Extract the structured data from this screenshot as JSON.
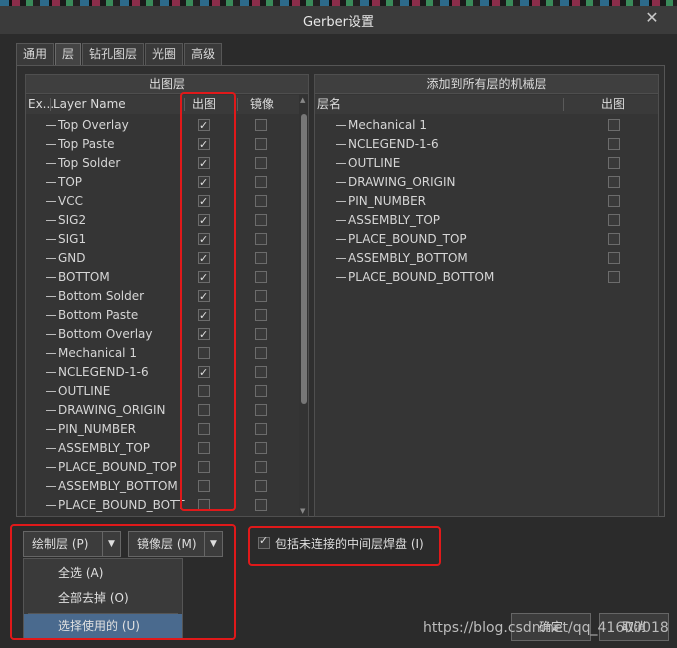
{
  "window": {
    "title": "Gerber设置",
    "close_label": "✕"
  },
  "tabs": [
    {
      "label": "通用"
    },
    {
      "label": "层"
    },
    {
      "label": "钻孔图层"
    },
    {
      "label": "光圈"
    },
    {
      "label": "高级"
    }
  ],
  "left_list": {
    "header": "出图层",
    "col_ex": "Ex...",
    "col_name": "Layer Name",
    "col_plot": "出图",
    "col_mirror": "镜像",
    "layers": [
      {
        "name": "Top Overlay",
        "plot": true,
        "mirror": false
      },
      {
        "name": "Top Paste",
        "plot": true,
        "mirror": false
      },
      {
        "name": "Top Solder",
        "plot": true,
        "mirror": false
      },
      {
        "name": "TOP",
        "plot": true,
        "mirror": false
      },
      {
        "name": "VCC",
        "plot": true,
        "mirror": false
      },
      {
        "name": "SIG2",
        "plot": true,
        "mirror": false
      },
      {
        "name": "SIG1",
        "plot": true,
        "mirror": false
      },
      {
        "name": "GND",
        "plot": true,
        "mirror": false
      },
      {
        "name": "BOTTOM",
        "plot": true,
        "mirror": false
      },
      {
        "name": "Bottom Solder",
        "plot": true,
        "mirror": false
      },
      {
        "name": "Bottom Paste",
        "plot": true,
        "mirror": false
      },
      {
        "name": "Bottom Overlay",
        "plot": true,
        "mirror": false
      },
      {
        "name": "Mechanical 1",
        "plot": false,
        "mirror": false
      },
      {
        "name": "NCLEGEND-1-6",
        "plot": true,
        "mirror": false
      },
      {
        "name": "OUTLINE",
        "plot": false,
        "mirror": false
      },
      {
        "name": "DRAWING_ORIGIN",
        "plot": false,
        "mirror": false
      },
      {
        "name": "PIN_NUMBER",
        "plot": false,
        "mirror": false
      },
      {
        "name": "ASSEMBLY_TOP",
        "plot": false,
        "mirror": false
      },
      {
        "name": "PLACE_BOUND_TOP",
        "plot": false,
        "mirror": false
      },
      {
        "name": "ASSEMBLY_BOTTOM",
        "plot": false,
        "mirror": false
      },
      {
        "name": "PLACE_BOUND_BOTT",
        "plot": false,
        "mirror": false
      }
    ]
  },
  "right_list": {
    "header": "添加到所有层的机械层",
    "col_name": "层名",
    "col_plot": "出图",
    "layers": [
      {
        "name": "Mechanical 1",
        "plot": false
      },
      {
        "name": "NCLEGEND-1-6",
        "plot": false
      },
      {
        "name": "OUTLINE",
        "plot": false
      },
      {
        "name": "DRAWING_ORIGIN",
        "plot": false
      },
      {
        "name": "PIN_NUMBER",
        "plot": false
      },
      {
        "name": "ASSEMBLY_TOP",
        "plot": false
      },
      {
        "name": "PLACE_BOUND_TOP",
        "plot": false
      },
      {
        "name": "ASSEMBLY_BOTTOM",
        "plot": false
      },
      {
        "name": "PLACE_BOUND_BOTTOM",
        "plot": false
      }
    ]
  },
  "buttons": {
    "plot_layers": "绘制层 (P)",
    "mirror_layers": "镜像层 (M)",
    "include_unconnected": "包括未连接的中间层焊盘 (I)",
    "include_unconnected_checked": true,
    "ok": "确定",
    "cancel": "取消"
  },
  "plot_menu": [
    {
      "label": "全选 (A)"
    },
    {
      "label": "全部去掉 (O)"
    },
    {
      "label": "选择使用的 (U)"
    }
  ],
  "watermark": "https://blog.csdn.net/qq_41600018",
  "colors": {
    "highlight_box": "#e0191a",
    "menu_selected": "#4a6a8e"
  }
}
